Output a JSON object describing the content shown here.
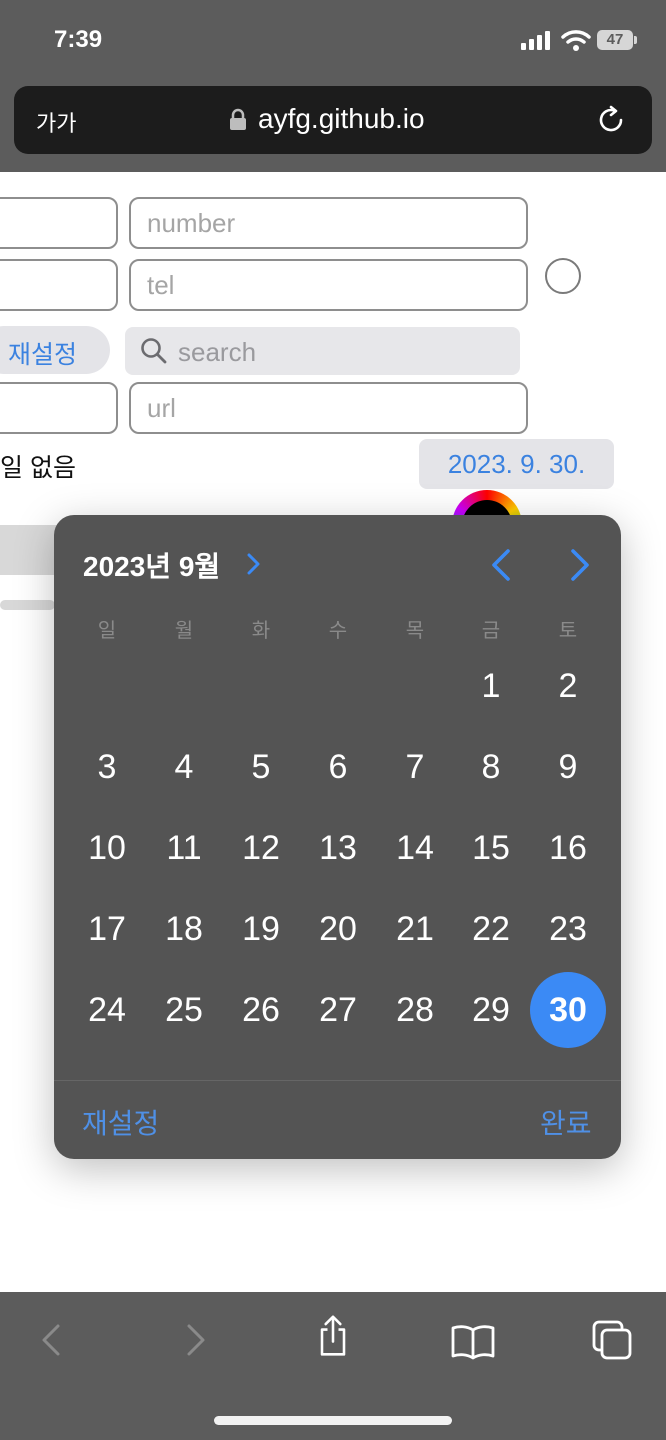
{
  "status_bar": {
    "time": "7:39",
    "battery": "47"
  },
  "browser": {
    "text_size_label": "가가",
    "url": "ayfg.github.io"
  },
  "form": {
    "number_placeholder": "number",
    "tel_placeholder": "tel",
    "reset_label": "재설정",
    "search_placeholder": "search",
    "url_placeholder": "url",
    "file_status": "일 없음",
    "date_value": "2023. 9. 30."
  },
  "picker": {
    "month_title": "2023년 9월",
    "weekdays": [
      "일",
      "월",
      "화",
      "수",
      "목",
      "금",
      "토"
    ],
    "days": [
      [
        "",
        "",
        "",
        "",
        "",
        "1",
        "2"
      ],
      [
        "3",
        "4",
        "5",
        "6",
        "7",
        "8",
        "9"
      ],
      [
        "10",
        "11",
        "12",
        "13",
        "14",
        "15",
        "16"
      ],
      [
        "17",
        "18",
        "19",
        "20",
        "21",
        "22",
        "23"
      ],
      [
        "24",
        "25",
        "26",
        "27",
        "28",
        "29",
        "30"
      ]
    ],
    "selected_day": "30",
    "reset_label": "재설정",
    "done_label": "완료"
  },
  "colors": {
    "accent": "#3b8af5",
    "picker_bg": "#545454",
    "link": "#4f90e6"
  },
  "icons": [
    "signal-icon",
    "wifi-icon",
    "battery-icon",
    "lock-icon",
    "reload-icon",
    "search-icon",
    "chevron-right-icon",
    "chevron-left-icon",
    "back-icon",
    "forward-icon",
    "share-icon",
    "bookmarks-icon",
    "tabs-icon"
  ]
}
